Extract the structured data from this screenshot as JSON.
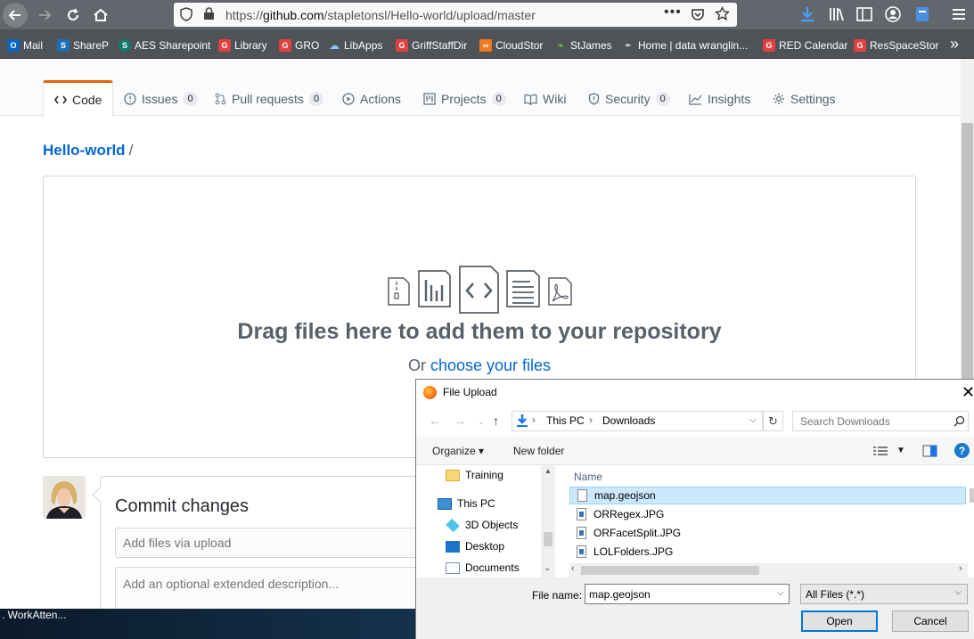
{
  "browser": {
    "url_prefix": "https://",
    "url_domain": "github.com",
    "url_path": "/stapletonsl/Hello-world/upload/master",
    "url_dots": "•••",
    "bookmarks": [
      {
        "label": "Mail",
        "icon": "outlook-icon",
        "glyph": "O"
      },
      {
        "label": "ShareP",
        "icon": "sharepoint-icon",
        "glyph": "S"
      },
      {
        "label": "AES Sharepoint",
        "icon": "sharepoint-icon",
        "glyph": "S"
      },
      {
        "label": "Library",
        "icon": "griffith-icon",
        "glyph": "G"
      },
      {
        "label": "GRO",
        "icon": "griffith-icon",
        "glyph": "G"
      },
      {
        "label": "LibApps",
        "icon": "libapps-icon",
        "glyph": "☁"
      },
      {
        "label": "GriffStaffDir",
        "icon": "griffith-icon",
        "glyph": "G"
      },
      {
        "label": "CloudStor",
        "icon": "cloudstor-icon",
        "glyph": "∞"
      },
      {
        "label": "StJames",
        "icon": "stjames-icon",
        "glyph": "❧"
      },
      {
        "label": "Home | data wranglin...",
        "icon": "bookmark-home-icon",
        "glyph": "✒"
      },
      {
        "label": "RED Calendar",
        "icon": "griffith-icon",
        "glyph": "G"
      },
      {
        "label": "ResSpaceStor",
        "icon": "griffith-icon",
        "glyph": "G"
      }
    ],
    "more": "»"
  },
  "repo_nav": {
    "code": "Code",
    "issues": "Issues",
    "issues_count": "0",
    "pull_requests": "Pull requests",
    "pull_requests_count": "0",
    "actions": "Actions",
    "projects": "Projects",
    "projects_count": "0",
    "wiki": "Wiki",
    "security": "Security",
    "security_count": "0",
    "insights": "Insights",
    "settings": "Settings"
  },
  "breadcrumb": {
    "repo": "Hello-world",
    "sep": "/"
  },
  "dropzone": {
    "title": "Drag files here to add them to your repository",
    "or": "Or ",
    "choose": "choose your files"
  },
  "commit": {
    "title": "Commit changes",
    "summary_placeholder": "Add files via upload",
    "description_placeholder": "Add an optional extended description..."
  },
  "taskbar": {
    "label": ". WorkAtten..."
  },
  "dialog": {
    "title": "File Upload",
    "close": "✕",
    "path": [
      "This PC",
      "Downloads"
    ],
    "search_placeholder": "Search Downloads",
    "organize": "Organize ▾",
    "new_folder": "New folder",
    "help": "?",
    "nav_items": [
      {
        "label": "Training",
        "icon": "folder-icon"
      },
      {
        "label": "This PC",
        "icon": "computer-icon"
      },
      {
        "label": "3D Objects",
        "icon": "3d-objects-icon"
      },
      {
        "label": "Desktop",
        "icon": "desktop-icon"
      },
      {
        "label": "Documents",
        "icon": "documents-icon"
      }
    ],
    "column_name": "Name",
    "files": [
      {
        "name": "map.geojson",
        "selected": true,
        "type": "file"
      },
      {
        "name": "ORRegex.JPG",
        "selected": false,
        "type": "image"
      },
      {
        "name": "ORFacetSplit.JPG",
        "selected": false,
        "type": "image"
      },
      {
        "name": "LOLFolders.JPG",
        "selected": false,
        "type": "image"
      }
    ],
    "file_name_label": "File name:",
    "file_name_value": "map.geojson",
    "filter": "All Files (*.*)",
    "open": "Open",
    "cancel": "Cancel"
  }
}
